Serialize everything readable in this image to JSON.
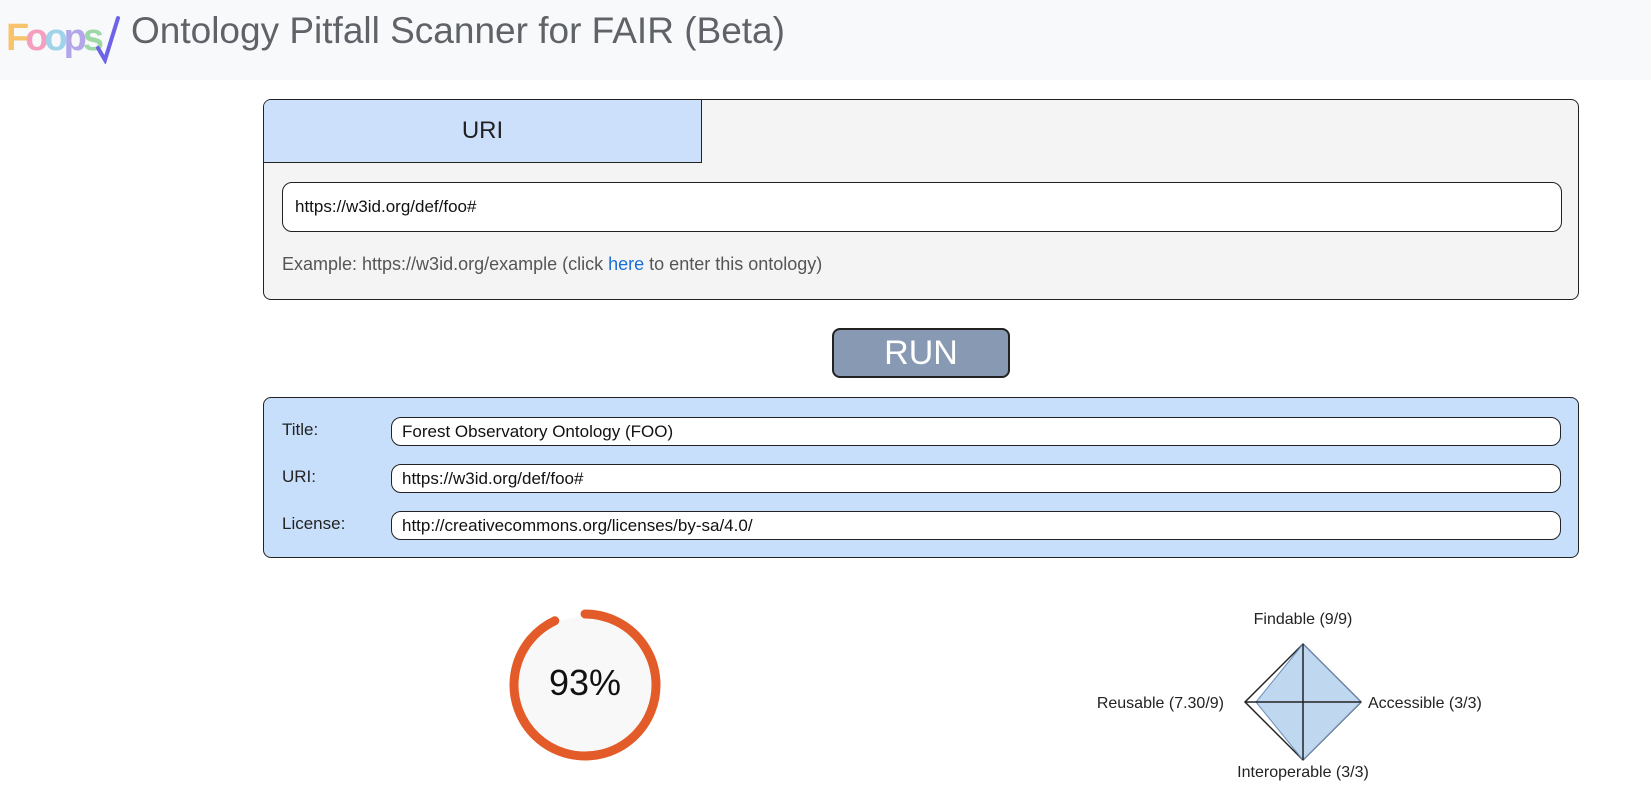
{
  "header": {
    "logo_text": "Foops",
    "app_title": "Ontology Pitfall Scanner for FAIR (Beta)"
  },
  "input_panel": {
    "tab_label": "URI",
    "uri_value": "https://w3id.org/def/foo#",
    "example_prefix": "Example: https://w3id.org/example (click ",
    "example_link": "here",
    "example_suffix": " to enter this ontology)"
  },
  "run_button": {
    "label": "RUN"
  },
  "metadata": {
    "title_label": "Title:",
    "title_value": "Forest Observatory Ontology (FOO)",
    "uri_label": "URI:",
    "uri_value": "https://w3id.org/def/foo#",
    "license_label": "License:",
    "license_value": "http://creativecommons.org/licenses/by-sa/4.0/"
  },
  "score": {
    "text": "93%",
    "fraction": 0.93,
    "color": "#e35b29"
  },
  "chart_data": {
    "type": "radar",
    "axes": [
      {
        "label": "Findable (9/9)",
        "value": 9,
        "max": 9
      },
      {
        "label": "Accessible (3/3)",
        "value": 3,
        "max": 3
      },
      {
        "label": "Interoperable (3/3)",
        "value": 3,
        "max": 3
      },
      {
        "label": "Reusable (7.30/9)",
        "value": 7.3,
        "max": 9
      }
    ],
    "fill_color": "#b9d3ee"
  }
}
